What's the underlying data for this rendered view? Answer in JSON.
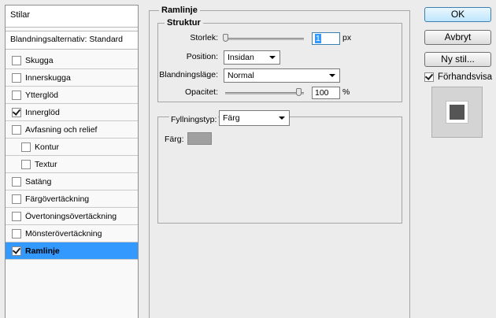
{
  "styles_panel": {
    "header": "Stilar",
    "blending": "Blandningsalternativ: Standard",
    "items": [
      {
        "label": "Skugga",
        "checked": false,
        "sub": false,
        "selected": false
      },
      {
        "label": "Innerskugga",
        "checked": false,
        "sub": false,
        "selected": false
      },
      {
        "label": "Ytterglöd",
        "checked": false,
        "sub": false,
        "selected": false
      },
      {
        "label": "Innerglöd",
        "checked": true,
        "sub": false,
        "selected": false
      },
      {
        "label": "Avfasning och relief",
        "checked": false,
        "sub": false,
        "selected": false
      },
      {
        "label": "Kontur",
        "checked": false,
        "sub": true,
        "selected": false
      },
      {
        "label": "Textur",
        "checked": false,
        "sub": true,
        "selected": false
      },
      {
        "label": "Satäng",
        "checked": false,
        "sub": false,
        "selected": false
      },
      {
        "label": "Färgövertäckning",
        "checked": false,
        "sub": false,
        "selected": false
      },
      {
        "label": "Övertoningsövertäckning",
        "checked": false,
        "sub": false,
        "selected": false
      },
      {
        "label": "Mönsterövertäckning",
        "checked": false,
        "sub": false,
        "selected": false
      },
      {
        "label": "Ramlinje",
        "checked": true,
        "sub": false,
        "selected": true
      }
    ]
  },
  "stroke": {
    "title": "Ramlinje",
    "structure": {
      "title": "Struktur",
      "size_label": "Storlek:",
      "size_value": "1",
      "size_unit": "px",
      "position_label": "Position:",
      "position_value": "Insidan",
      "blend_label": "Blandningsläge:",
      "blend_value": "Normal",
      "opacity_label": "Opacitet:",
      "opacity_value": "100",
      "opacity_unit": "%",
      "size_slider_fraction": 0.0,
      "opacity_slider_fraction": 1.0
    },
    "fill": {
      "type_label": "Fyllningstyp:",
      "type_value": "Färg",
      "color_label": "Färg:",
      "color": "#a0a0a0"
    }
  },
  "buttons": {
    "ok": "OK",
    "cancel": "Avbryt",
    "new_style": "Ny stil...",
    "preview_label": "Förhandsvisa",
    "preview_checked": true
  },
  "colors": {
    "selection": "#3399ff",
    "preview_core": "#555555"
  }
}
